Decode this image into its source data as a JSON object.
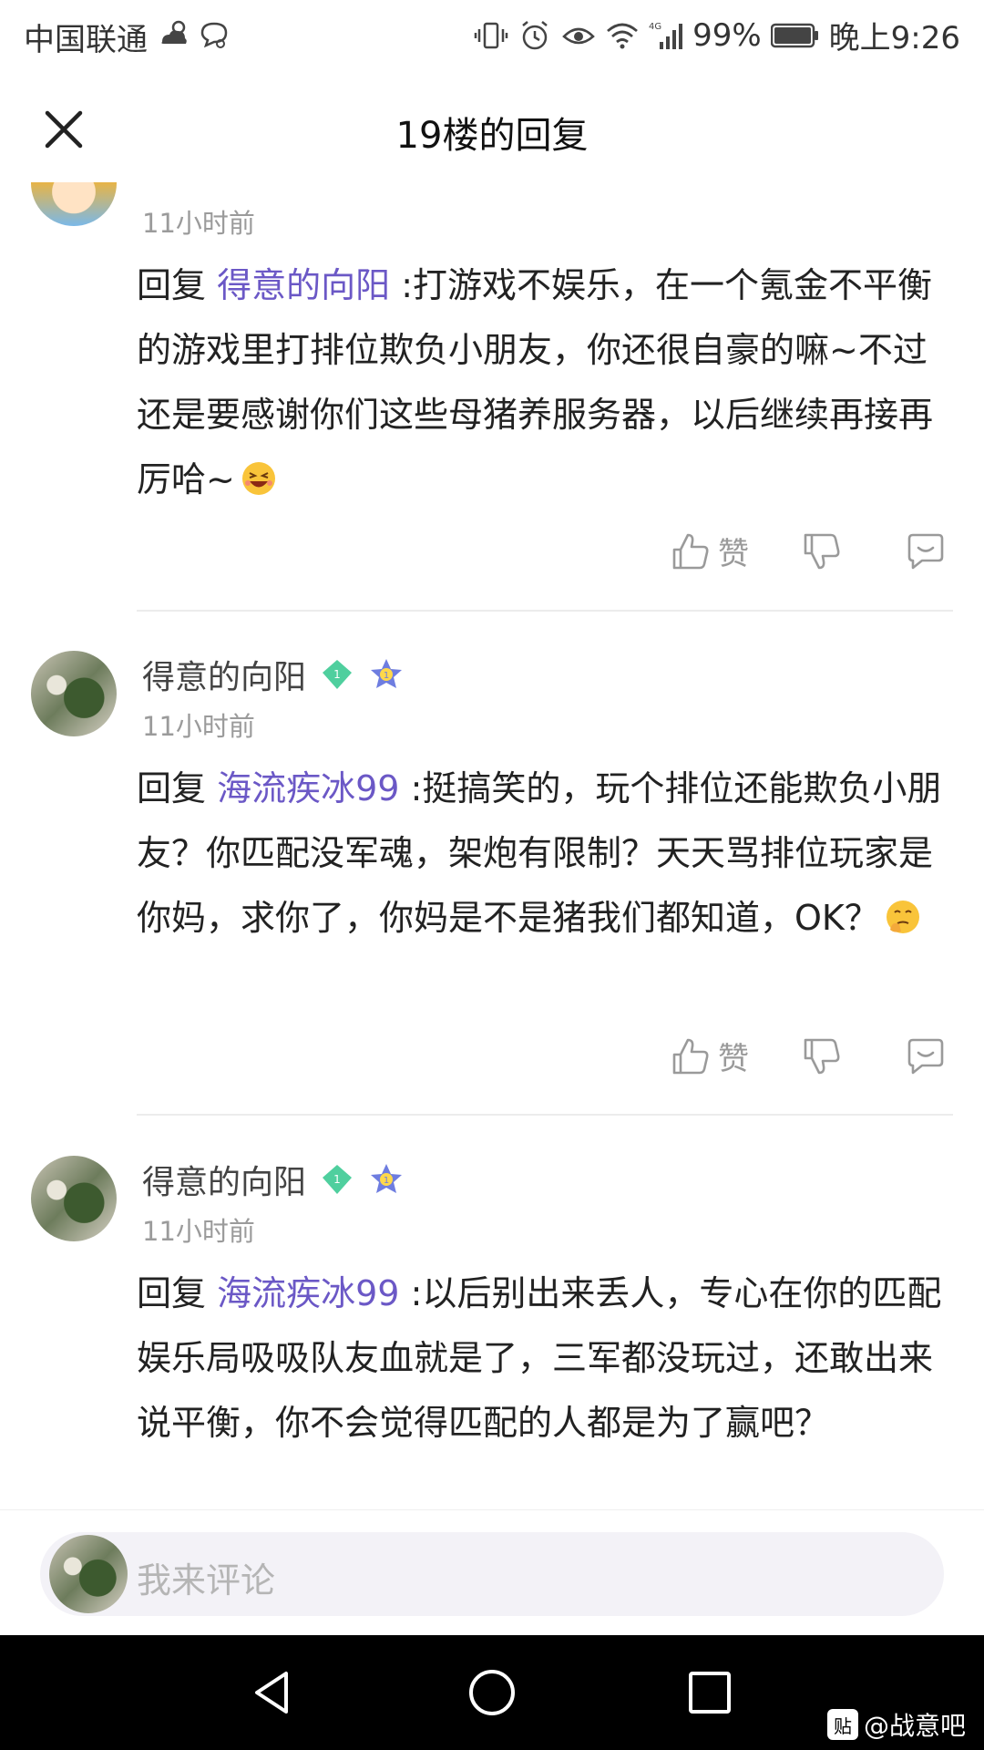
{
  "status_bar": {
    "carrier": "中国联通",
    "battery": "99%",
    "time": "晚上9:26",
    "network": "4G"
  },
  "header": {
    "title": "19楼的回复"
  },
  "comments": [
    {
      "username": "",
      "time": "11小时前",
      "reply_prefix": "回复",
      "reply_target": "得意的向阳",
      "text": ":打游戏不娱乐，在一个氪金不平衡的游戏里打排位欺负小朋友，你还很自豪的嘛~不过还是要感谢你们这些母猪养服务器，以后继续再接再厉哈~",
      "emoji": "laughing-emoji",
      "like_label": "赞"
    },
    {
      "username": "得意的向阳",
      "badge_level": "1",
      "time": "11小时前",
      "reply_prefix": "回复",
      "reply_target": "海流疾冰99",
      "text": ":挺搞笑的，玩个排位还能欺负小朋友？你匹配没军魂，架炮有限制？天天骂排位玩家是你妈，求你了，你妈是不是猪我们都知道，OK？",
      "emoji": "thinking-emoji",
      "like_label": "赞"
    },
    {
      "username": "得意的向阳",
      "badge_level": "1",
      "time": "11小时前",
      "reply_prefix": "回复",
      "reply_target": "海流疾冰99",
      "text": ":以后别出来丢人，专心在你的匹配娱乐局吸吸队友血就是了，三军都没玩过，还敢出来说平衡，你不会觉得匹配的人都是为了赢吧？"
    }
  ],
  "comment_bar": {
    "placeholder": "我来评论"
  },
  "watermark": {
    "logo": "贴",
    "text": "@战意吧"
  },
  "colors": {
    "accent": "#6b58c6",
    "muted": "#9b9b9b"
  }
}
